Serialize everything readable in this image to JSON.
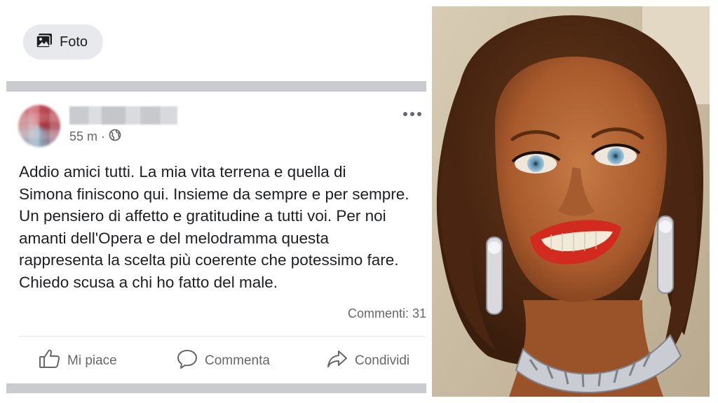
{
  "composer": {
    "photo_button_label": "Foto",
    "photo_icon": "photo-icon"
  },
  "post": {
    "author_name": "",
    "time": "55 m",
    "separator": "·",
    "audience_icon": "globe-icon",
    "more_icon": "more-icon",
    "text": "Addio amici tutti. La mia vita terrena e quella di\nSimona finiscono qui. Insieme da sempre e per sempre.\nUn pensiero di affetto e gratitudine a tutti voi. Per noi\namanti dell'Opera e del melodramma questa\nrappresenta la scelta più coerente che potessimo fare.\nChiedo scusa a chi ho fatto del male.",
    "comments_label": "Commenti: 31"
  },
  "actions": {
    "like_label": "Mi piace",
    "like_icon": "thumbs-up-icon",
    "comment_label": "Commenta",
    "comment_icon": "comment-icon",
    "share_label": "Condividi",
    "share_icon": "share-icon"
  },
  "colors": {
    "muted_text": "#65676b",
    "divider": "#c9cbcf",
    "chip_bg": "#e8e9ec"
  }
}
